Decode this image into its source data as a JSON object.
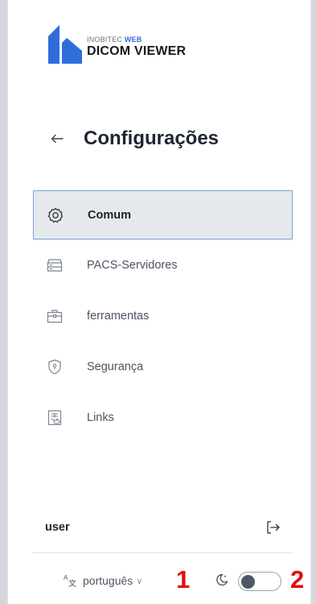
{
  "brand": {
    "top_prefix": "INOBITEC",
    "top_accent": "WEB",
    "name": "DICOM VIEWER",
    "logo_color": "#2f6ed9"
  },
  "header": {
    "back_icon": "arrow-left-icon",
    "title": "Configurações"
  },
  "menu": {
    "active_index": 0,
    "items": [
      {
        "label": "Comum",
        "icon": "gear-icon"
      },
      {
        "label": "PACS-Servidores",
        "icon": "server-icon"
      },
      {
        "label": "ferramentas",
        "icon": "toolbox-icon"
      },
      {
        "label": "Segurança",
        "icon": "shield-icon"
      },
      {
        "label": "Links",
        "icon": "link-document-icon"
      }
    ]
  },
  "user": {
    "name": "user",
    "logout_icon": "logout-icon"
  },
  "footer": {
    "language": "português",
    "dark_mode_enabled": false
  },
  "annotations": {
    "marker_1": "1",
    "marker_2": "2",
    "color": "#e10d0d"
  }
}
